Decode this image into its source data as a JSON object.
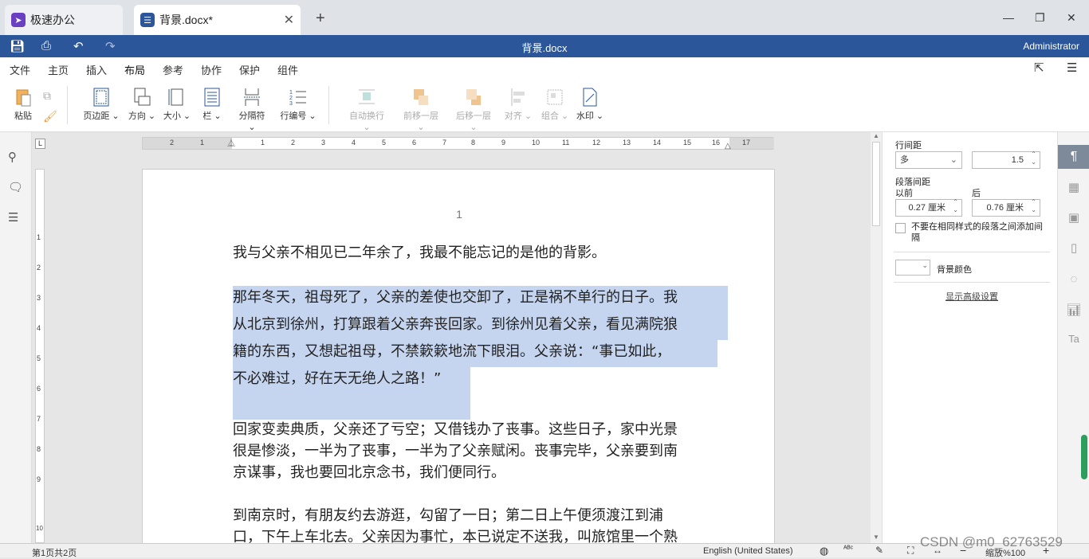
{
  "tabs": [
    {
      "label": "极速办公"
    },
    {
      "label": "背景.docx*"
    }
  ],
  "window": {
    "title": "背景.docx",
    "user": "Administrator"
  },
  "menu": [
    "文件",
    "主页",
    "插入",
    "布局",
    "参考",
    "协作",
    "保护",
    "组件"
  ],
  "toolbar": {
    "paste": "粘贴",
    "margins": "页边距",
    "orientation": "方向",
    "size": "大小",
    "columns": "栏",
    "breaks": "分隔符",
    "line_numbers": "行编号",
    "wrap": "自动换行",
    "bring_forward": "前移一层",
    "send_backward": "后移一层",
    "align": "对齐",
    "group": "组合",
    "watermark": "水印"
  },
  "ruler": {
    "labels": [
      "2",
      "1",
      "1",
      "2",
      "3",
      "4",
      "5",
      "6",
      "7",
      "8",
      "9",
      "10",
      "11",
      "12",
      "13",
      "14",
      "15",
      "16",
      "17"
    ]
  },
  "vruler": {
    "labels": [
      "1",
      "2",
      "3",
      "4",
      "5",
      "6",
      "7",
      "8",
      "9",
      "10"
    ]
  },
  "document": {
    "page_number": "1",
    "lines": [
      "我与父亲不相见已二年余了，我最不能忘记的是他的背影。",
      "那年冬天，祖母死了，父亲的差使也交卸了，正是祸不单行的日子。我",
      "从北京到徐州，打算跟着父亲奔丧回家。到徐州见着父亲，看见满院狼",
      "籍的东西，又想起祖母，不禁簌簌地流下眼泪。父亲说：“事已如此，",
      "不必难过，好在天无绝人之路！”",
      "回家变卖典质，父亲还了亏空；又借钱办了丧事。这些日子，家中光景",
      "很是惨淡，一半为了丧事，一半为了父亲赋闲。丧事完毕，父亲要到南",
      "京谋事，我也要回北京念书，我们便同行。",
      "到南京时，有朋友约去游逛，勾留了一日；第二日上午便须渡江到浦",
      "口，下午上车北去。父亲因为事忙，本已说定不送我，叫旅馆里一个熟"
    ]
  },
  "panel": {
    "line_spacing_label": "行间距",
    "line_spacing_mode": "多",
    "line_spacing_value": "1.5",
    "para_spacing_label": "段落间距",
    "before_label": "以前",
    "after_label": "后",
    "before_value": "0.27 厘米",
    "after_value": "0.76 厘米",
    "no_space_same_style": "不要在相同样式的段落之间添加间隔",
    "bg_color_label": "背景颜色",
    "advanced": "显示高级设置"
  },
  "status": {
    "page": "第1页共2页",
    "language": "English (United States)",
    "zoom": "缩放%100"
  },
  "watermark_text": "CSDN @m0_62763529",
  "colors": {
    "accent": "#2b579a",
    "selection": "#c6d5ef"
  }
}
